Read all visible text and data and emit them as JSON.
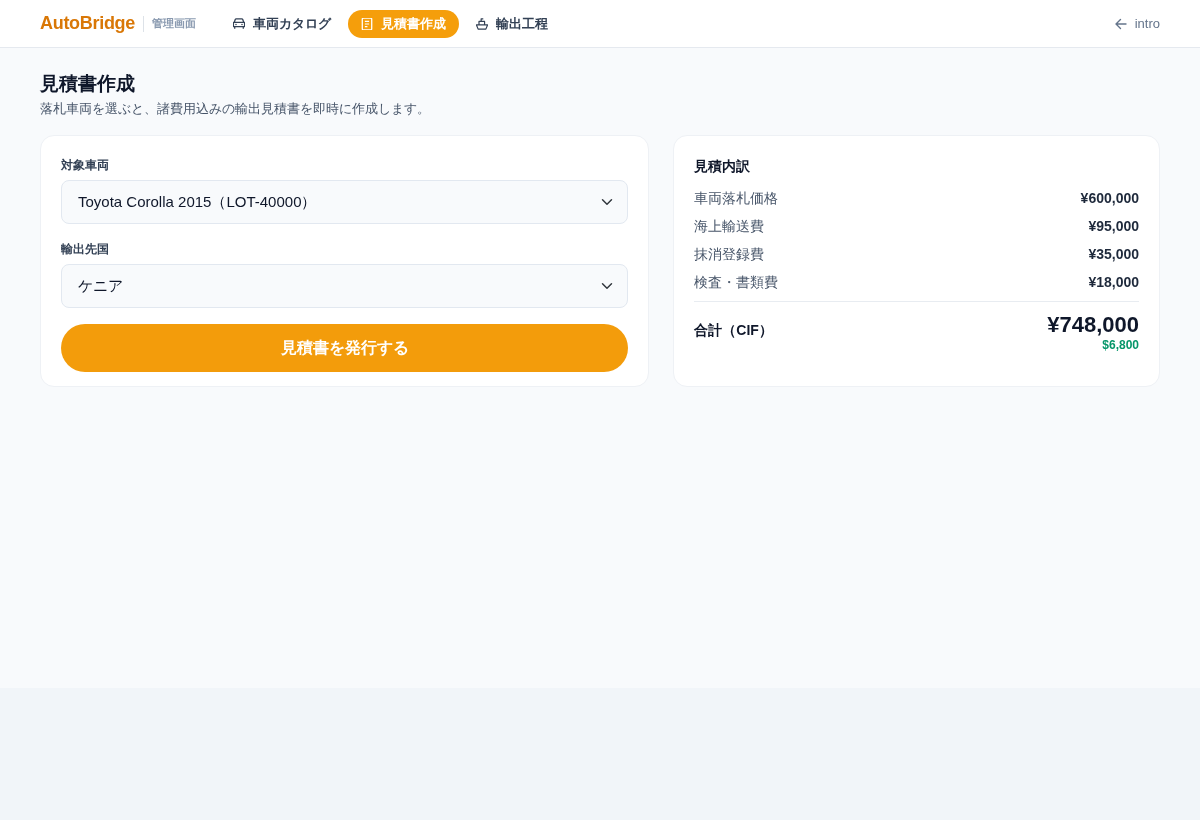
{
  "nav": {
    "brand": "AutoBridge",
    "brand_sub": "管理画面",
    "tabs": [
      {
        "label": "車両カタログ",
        "selected": false
      },
      {
        "label": "見積書作成",
        "selected": true
      },
      {
        "label": "輸出工程",
        "selected": false
      }
    ],
    "back_link": "intro"
  },
  "page": {
    "title": "見積書作成",
    "subtitle": "落札車両を選ぶと、諸費用込みの輸出見積書を即時に作成します。"
  },
  "form": {
    "fields": [
      {
        "label": "対象車両",
        "value": "Toyota Corolla 2015（LOT-40000）"
      },
      {
        "label": "輸出先国",
        "value": "ケニア"
      }
    ],
    "submit": "見積書を発行する"
  },
  "breakdown": {
    "title": "見積内訳",
    "items": [
      {
        "label": "車両落札価格",
        "amount": "¥600,000"
      },
      {
        "label": "海上輸送費",
        "amount": "¥95,000"
      },
      {
        "label": "抹消登録費",
        "amount": "¥35,000"
      },
      {
        "label": "検査・書類費",
        "amount": "¥18,000"
      }
    ],
    "total": {
      "label": "合計（CIF）",
      "amount": "¥748,000",
      "usd": "$6,800"
    }
  }
}
